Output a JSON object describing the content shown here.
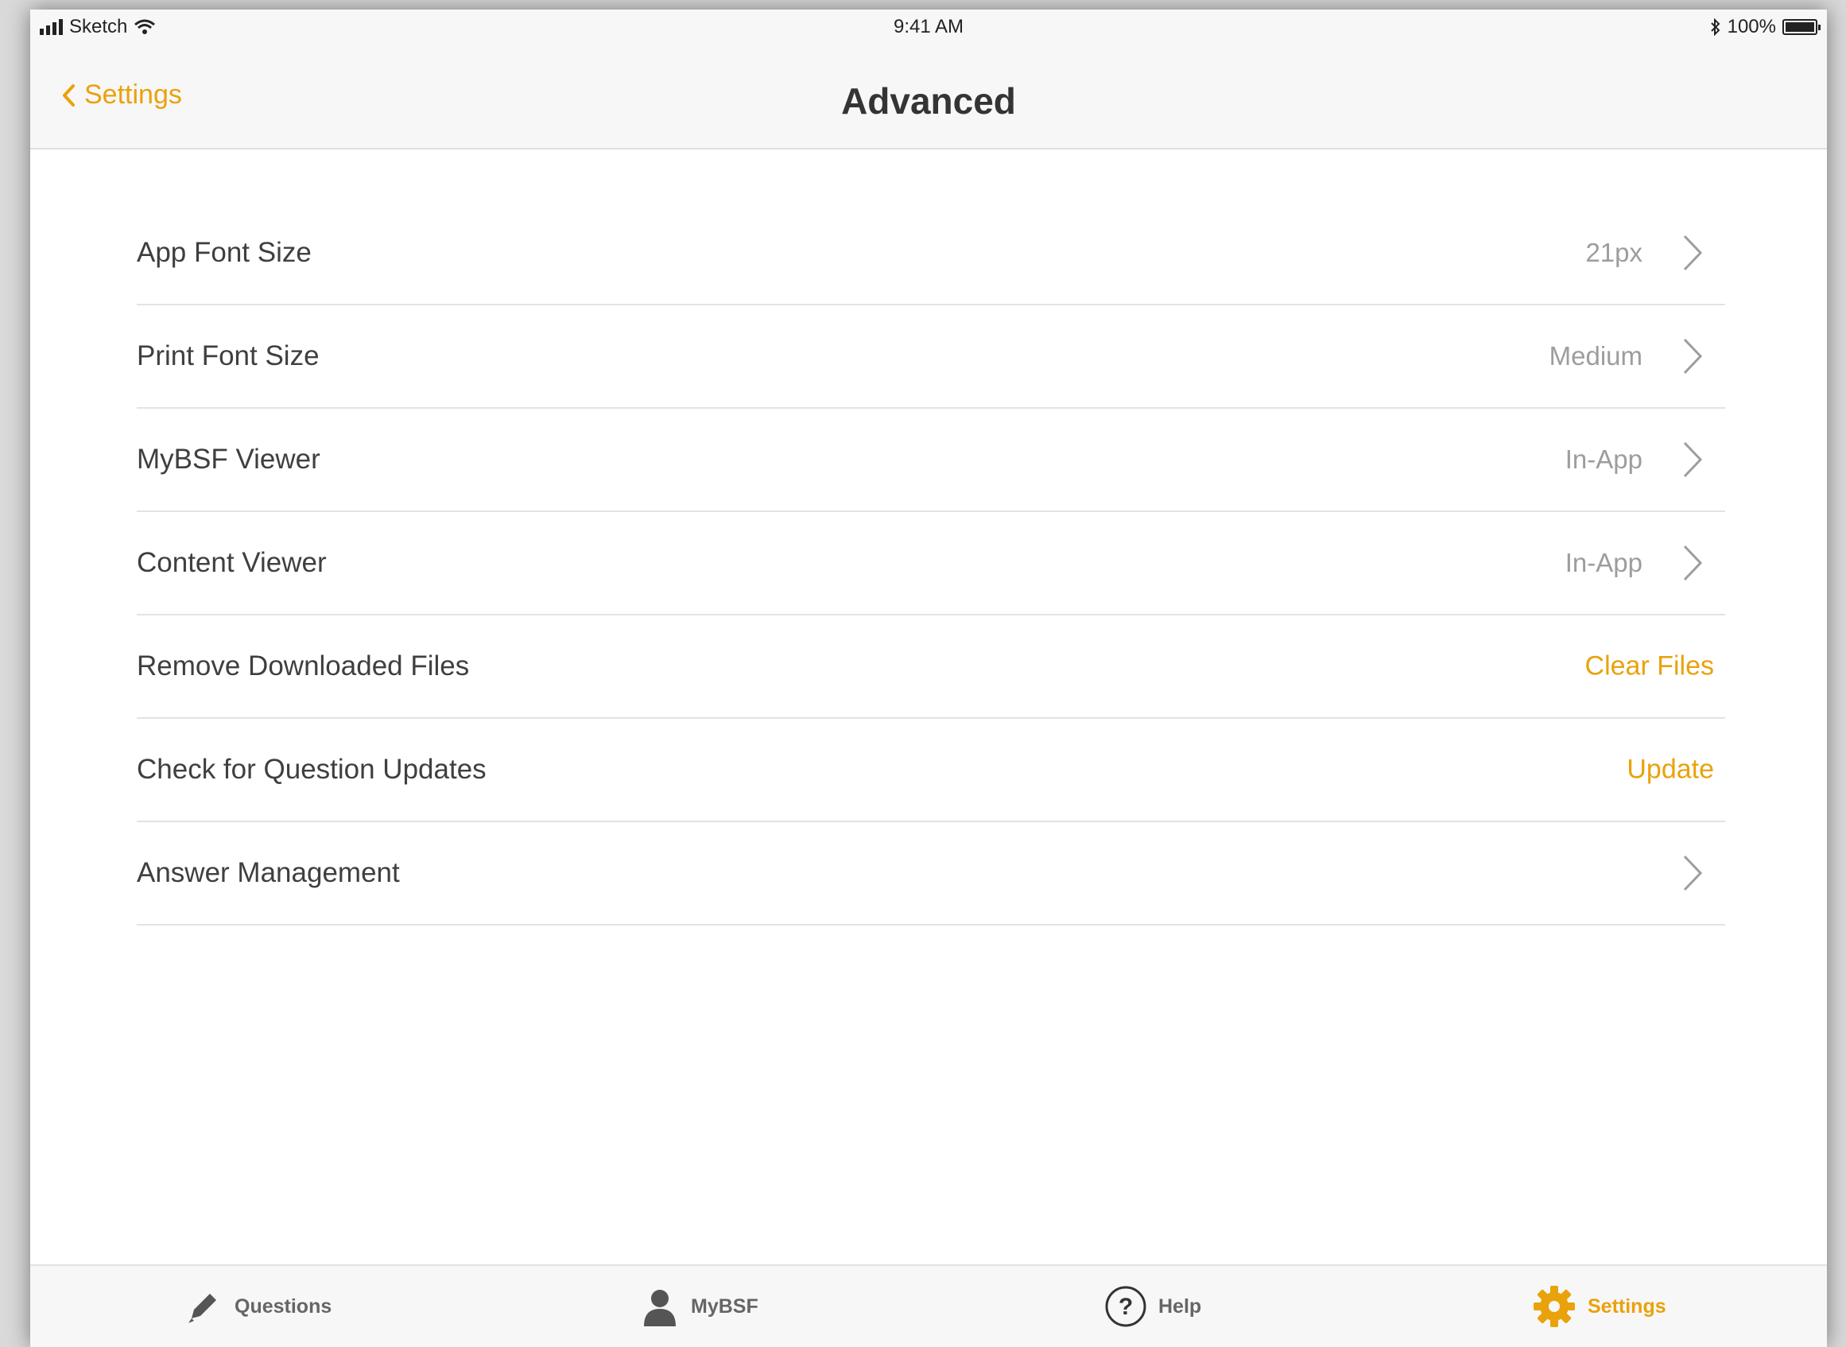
{
  "status_bar": {
    "carrier": "Sketch",
    "time": "9:41 AM",
    "battery": "100%",
    "icons": [
      "signal-icon",
      "wifi-icon",
      "bluetooth-icon",
      "battery-icon"
    ]
  },
  "nav": {
    "back_label": "Settings",
    "title": "Advanced"
  },
  "rows": [
    {
      "label": "App Font Size",
      "value": "21px"
    },
    {
      "label": "Print Font Size",
      "value": "Medium"
    },
    {
      "label": "MyBSF Viewer",
      "value": "In-App"
    },
    {
      "label": "Content Viewer",
      "value": "In-App"
    },
    {
      "label": "Remove Downloaded Files",
      "action": "Clear Files"
    },
    {
      "label": "Check for Question Updates",
      "action": "Update"
    },
    {
      "label": "Answer Management"
    }
  ],
  "tabs": [
    {
      "label": "Questions",
      "icon": "pencil-icon"
    },
    {
      "label": "MyBSF",
      "icon": "person-icon"
    },
    {
      "label": "Help",
      "icon": "help-icon"
    },
    {
      "label": "Settings",
      "icon": "gear-icon",
      "active": true
    }
  ],
  "colors": {
    "accent": "#e9a20b",
    "text": "#3f3f3f",
    "secondary_text": "#9d9d9d",
    "separator": "#e3e3e3",
    "bar_background": "#f7f7f7"
  }
}
